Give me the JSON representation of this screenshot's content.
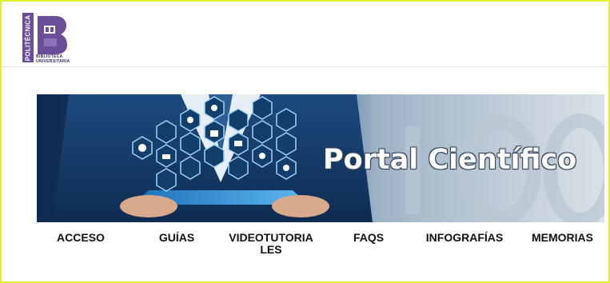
{
  "logo": {
    "band_text": "POLITÉCNICA",
    "subtitle_line1": "BIBLIOTECA",
    "subtitle_line2": "UNIVERSITARIA",
    "brand_color": "#6a4e9a"
  },
  "banner": {
    "title": "Portal Científico",
    "icons": [
      "gear-icon",
      "lightbulb-icon",
      "wifi-icon",
      "tools-icon",
      "chart-icon",
      "person-icon",
      "at-icon",
      "network-icon",
      "robot-arm-icon",
      "pie-chart-icon",
      "cloud-icon",
      "truck-icon"
    ]
  },
  "nav": {
    "items": [
      {
        "label": "ACCESO"
      },
      {
        "label": "GUÍAS"
      },
      {
        "label": "VIDEOTUTORIA LES"
      },
      {
        "label": "FAQS"
      },
      {
        "label": "INFOGRAFÍAS"
      },
      {
        "label": "MEMORIAS"
      }
    ]
  },
  "colors": {
    "frame": "#e3ee2c",
    "accent": "#6a4e9a",
    "banner_dark": "#1b3a63"
  }
}
